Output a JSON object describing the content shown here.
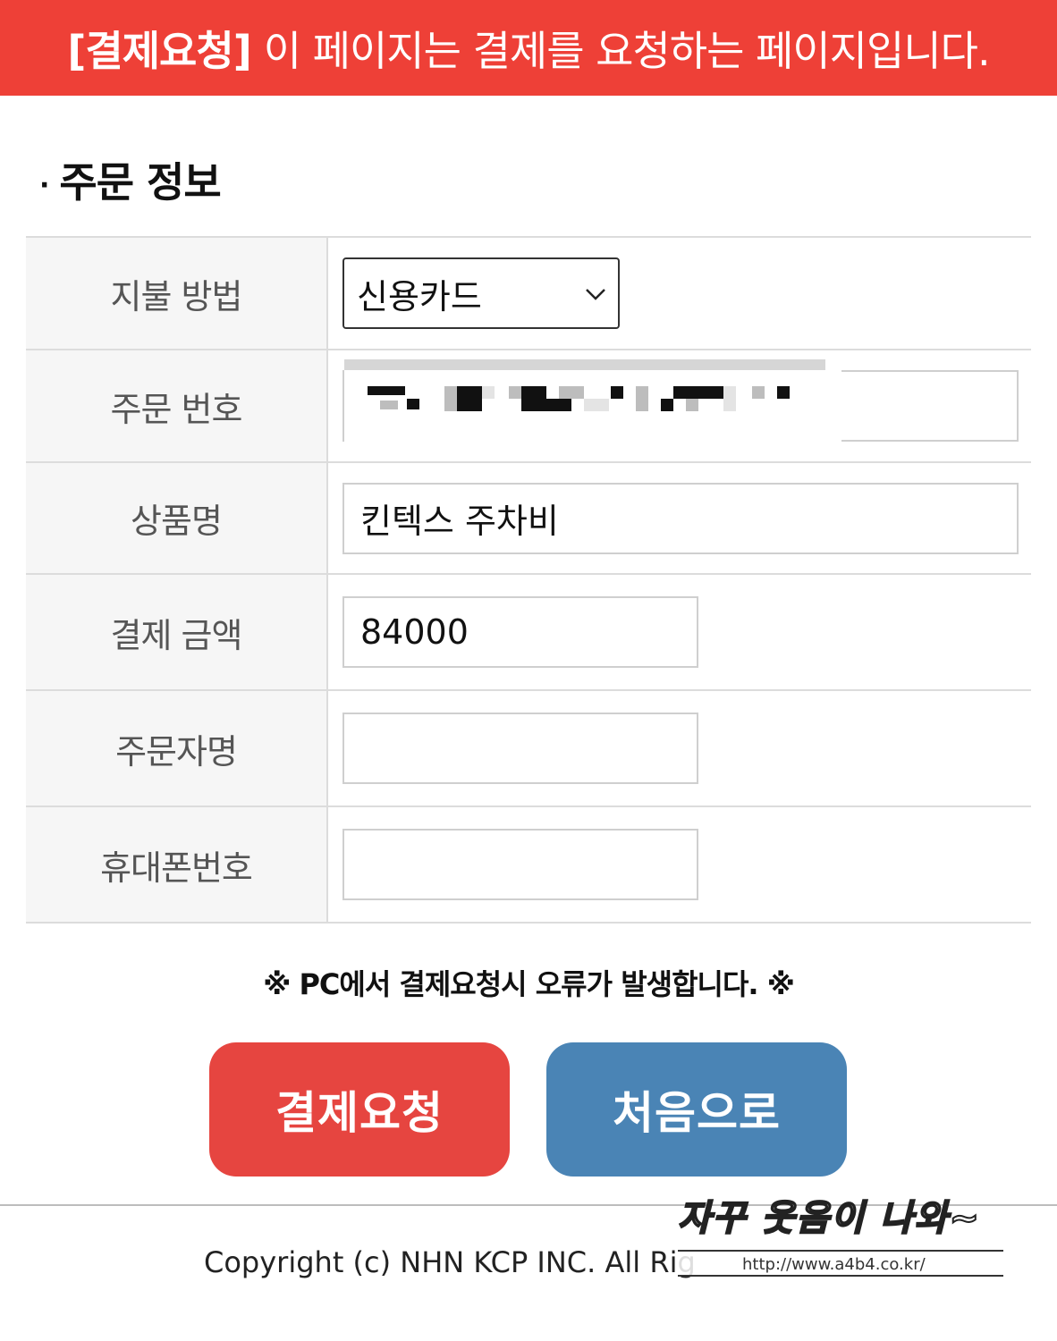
{
  "banner": {
    "tag": "[결제요청]",
    "message": "이 페이지는 결제를 요청하는 페이지입니다."
  },
  "section": {
    "bullet": "·",
    "title": "주문 정보"
  },
  "form": {
    "payment_method": {
      "label": "지불 방법",
      "value": "신용카드"
    },
    "order_number": {
      "label": "주문 번호",
      "value": ""
    },
    "product_name": {
      "label": "상품명",
      "value": "킨텍스 주차비"
    },
    "amount": {
      "label": "결제 금액",
      "value": "84000"
    },
    "orderer_name": {
      "label": "주문자명",
      "value": ""
    },
    "phone": {
      "label": "휴대폰번호",
      "value": ""
    }
  },
  "notice": "※ PC에서 결제요청시 오류가 발생합니다. ※",
  "buttons": {
    "pay": "결제요청",
    "home": "처음으로"
  },
  "footer": {
    "copyright": "Copyright (c) NHN KCP INC. All Rig"
  },
  "watermark": {
    "caption": "자꾸 웃음이 나와~",
    "url": "http://www.a4b4.co.kr/"
  },
  "colors": {
    "banner": "#ee4037",
    "pay_button": "#e64540",
    "home_button": "#4a84b5"
  }
}
